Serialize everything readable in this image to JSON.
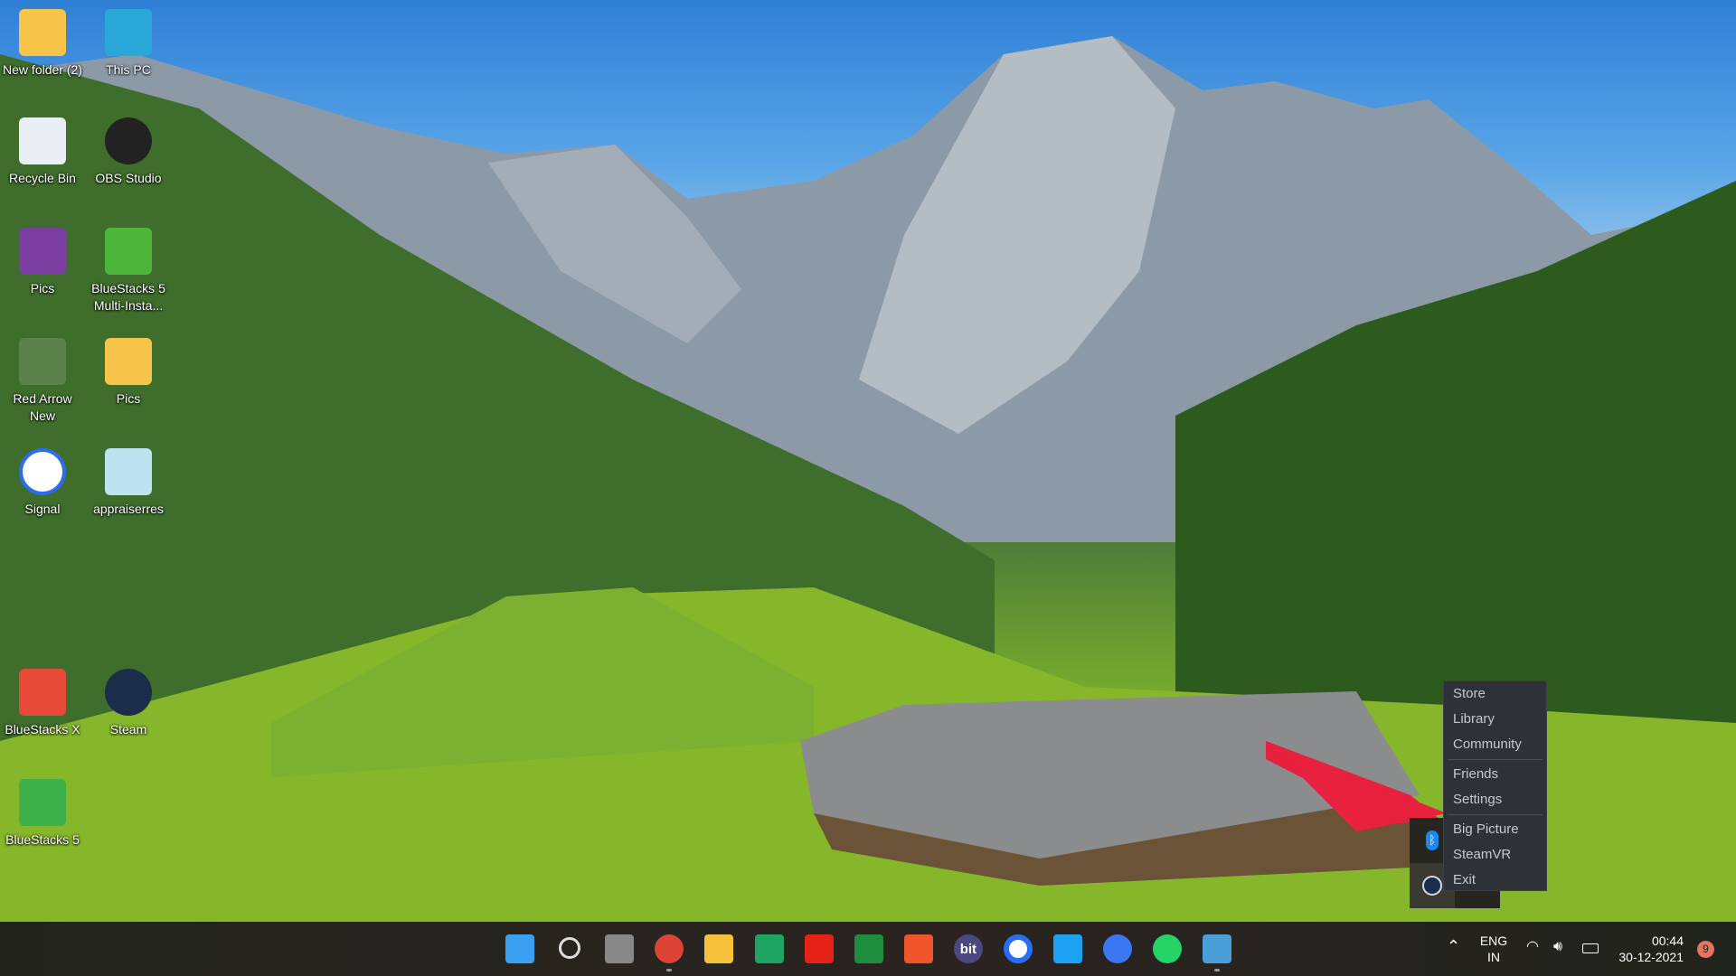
{
  "desktop": {
    "icons": [
      {
        "label": "New folder (2)",
        "icon": "folder-icon"
      },
      {
        "label": "This PC",
        "icon": "monitor-icon"
      },
      {
        "label": "Recycle Bin",
        "icon": "recycle-bin-icon"
      },
      {
        "label": "OBS Studio",
        "icon": "obs-icon"
      },
      {
        "label": "Pics",
        "icon": "winrar-icon"
      },
      {
        "label": "BlueStacks 5 Multi-Insta...",
        "icon": "bluestacks-multi-icon"
      },
      {
        "label": "Red Arrow New",
        "icon": "red-arrow-image-icon"
      },
      {
        "label": "Pics",
        "icon": "folder-icon"
      },
      {
        "label": "Signal",
        "icon": "signal-icon"
      },
      {
        "label": "appraiserres",
        "icon": "notepad-file-icon"
      },
      {
        "label": "BlueStacks X",
        "icon": "bluestacks-x-icon"
      },
      {
        "label": "Steam",
        "icon": "steam-icon"
      },
      {
        "label": "BlueStacks 5",
        "icon": "bluestacks-icon"
      }
    ]
  },
  "steam_menu": {
    "items": [
      "Store",
      "Library",
      "Community",
      "Friends",
      "Settings",
      "Big Picture",
      "SteamVR",
      "Exit"
    ]
  },
  "taskbar": {
    "apps": [
      "Start",
      "Search",
      "Task View",
      "Google Chrome",
      "File Explorer",
      "Google Drive",
      "YouTube",
      "Google Sheets",
      "Brave",
      "bit",
      "Ccleaner",
      "Twitter",
      "Signal",
      "WhatsApp",
      "Control Panel"
    ],
    "bit_label": "bit"
  },
  "tray": {
    "lang_top": "ENG",
    "lang_bottom": "IN",
    "time": "00:44",
    "date": "30-12-2021",
    "notifications": "9"
  },
  "colors": {
    "menu_bg": "#2f3138",
    "taskbar": "#23251c",
    "arrow": "#e8213f",
    "badge": "#e8735d"
  }
}
